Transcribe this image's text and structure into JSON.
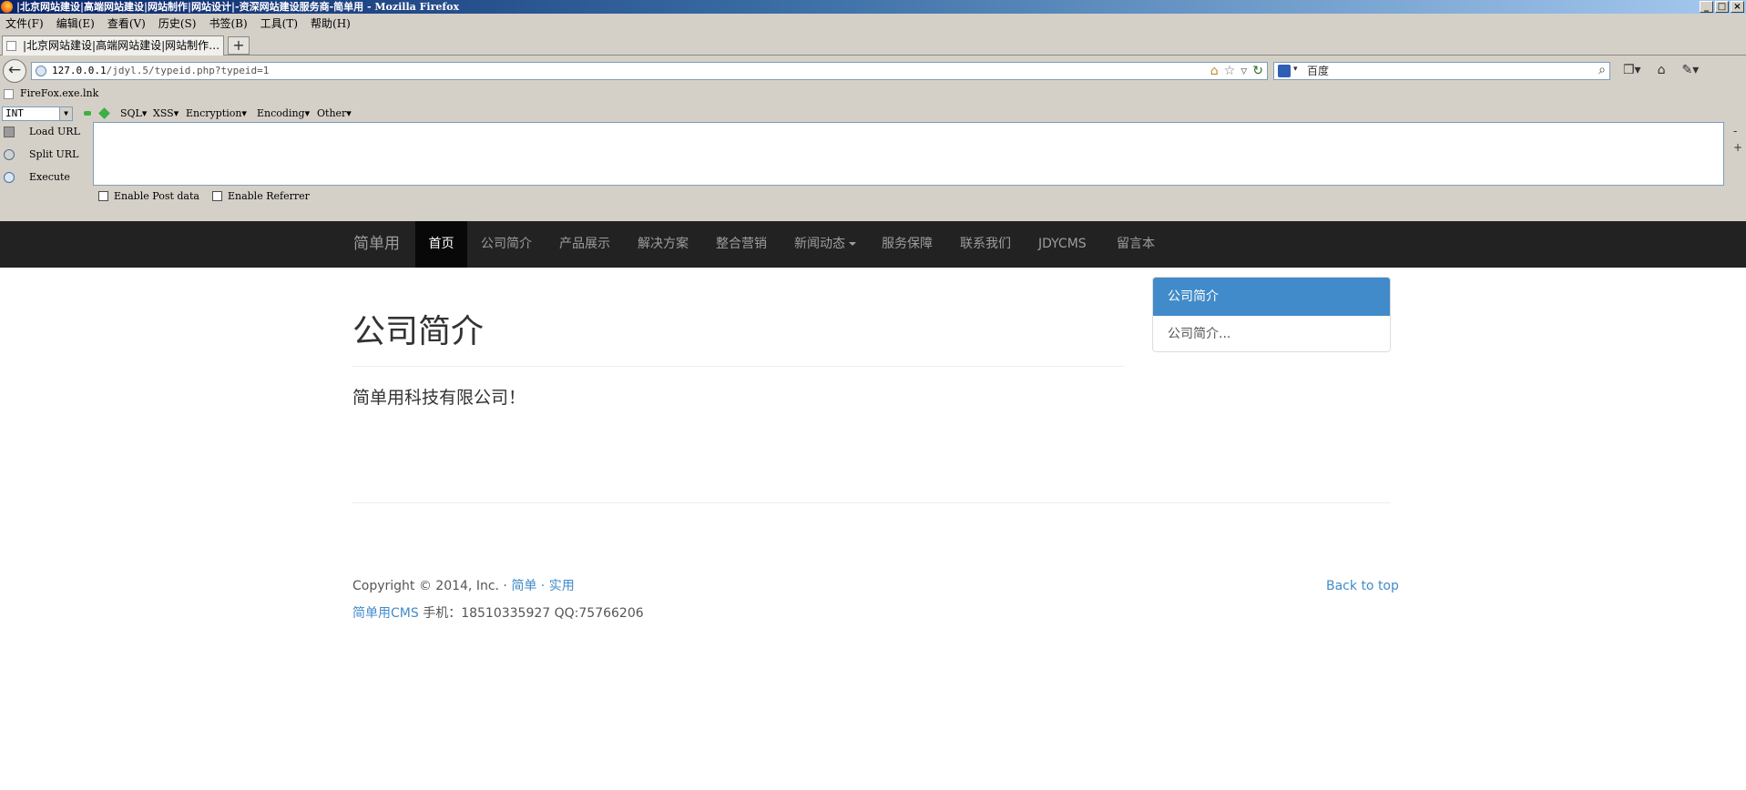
{
  "window": {
    "title": "|北京网站建设|高端网站建设|网站制作|网站设计|-资深网站建设服务商-简单用 - Mozilla Firefox",
    "controls": [
      "_",
      "□",
      "×"
    ]
  },
  "menubar": [
    "文件(F)",
    "编辑(E)",
    "查看(V)",
    "历史(S)",
    "书签(B)",
    "工具(T)",
    "帮助(H)"
  ],
  "tabs": [
    {
      "label": "|北京网站建设|高端网站建设|网站制作…",
      "active": true
    }
  ],
  "new_tab_label": "+",
  "address": {
    "host": "127.0.0.1",
    "path": "/jdyl.5/typeid.php?typeid=1"
  },
  "search": {
    "engine_icon": "baidu-icon",
    "placeholder": "百度"
  },
  "bookmarks": [
    "FireFox.exe.lnk"
  ],
  "hackbar": {
    "select_value": "INT",
    "menus": [
      "SQL▾",
      "XSS▾",
      "Encryption▾",
      "Encoding▾",
      "Other▾"
    ],
    "actions": [
      "Load URL",
      "Split URL",
      "Execute"
    ],
    "textarea_value": "",
    "checkboxes": [
      "Enable Post data",
      "Enable Referrer"
    ],
    "side_buttons": [
      "-",
      "+"
    ]
  },
  "site": {
    "brand": "简单用",
    "nav": [
      "首页",
      "公司简介",
      "产品展示",
      "解决方案",
      "整合营销",
      "新闻动态",
      "服务保障",
      "联系我们",
      "JDYCMS",
      "留言本"
    ],
    "active_nav": "首页",
    "page_title": "公司简介",
    "body_text": "简单用科技有限公司！",
    "side_panel": {
      "heading": "公司简介",
      "item": "公司简介..."
    },
    "footer": {
      "copyright": "Copyright © 2014, Inc. · ",
      "link1": "简单",
      "sep": " · ",
      "link2": "实用",
      "cms_link": "简单用CMS",
      "contact": " 手机：18510335927 QQ:75766206",
      "back_to_top": "Back to top"
    }
  },
  "colors": {
    "navbar_bg": "#222222",
    "navbar_active_bg": "#080808",
    "panel_heading": "#428bca",
    "link": "#428bca"
  }
}
